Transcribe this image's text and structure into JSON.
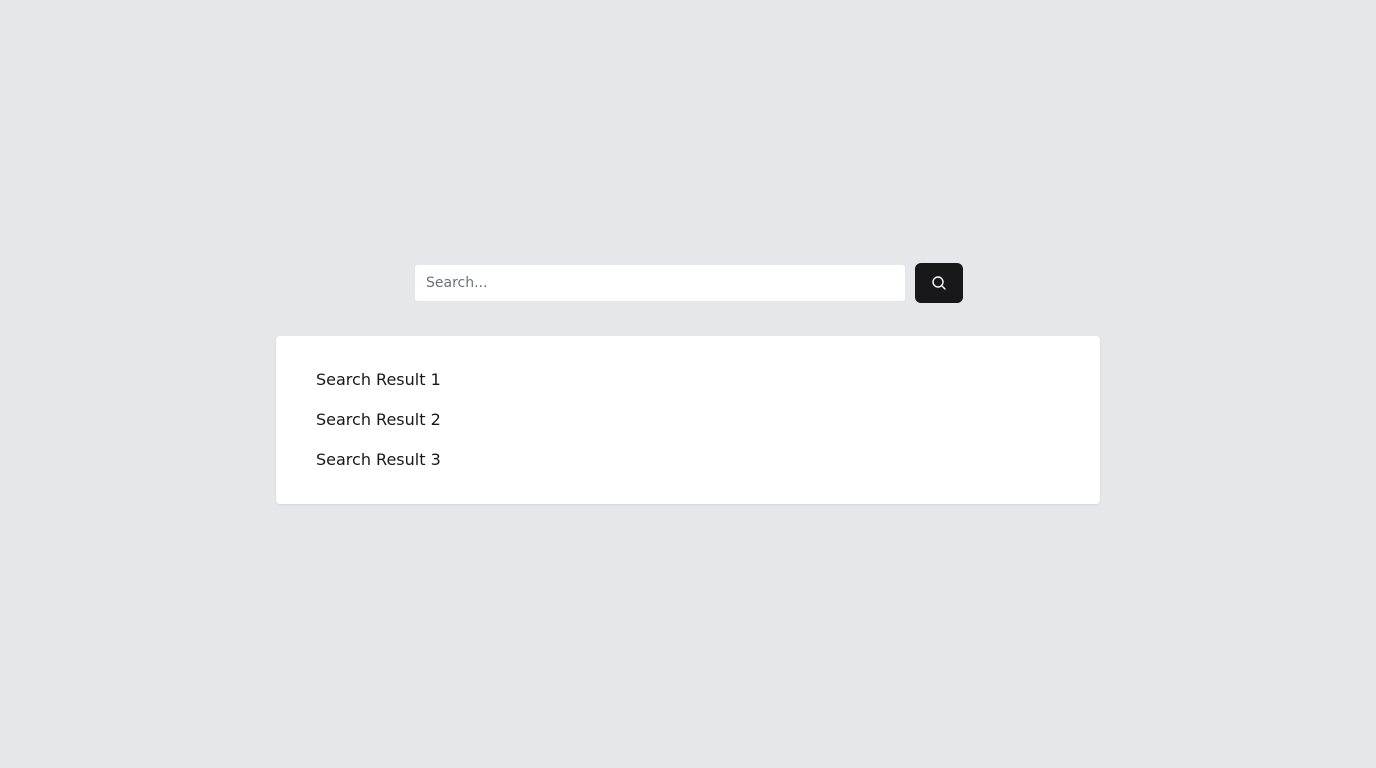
{
  "search": {
    "placeholder": "Search...",
    "value": "",
    "button_icon": "search-icon"
  },
  "results": {
    "items": [
      {
        "label": "Search Result 1"
      },
      {
        "label": "Search Result 2"
      },
      {
        "label": "Search Result 3"
      }
    ]
  },
  "colors": {
    "background": "#e5e7eb",
    "card": "#ffffff",
    "button": "#18181b",
    "text": "#18181b",
    "placeholder": "#6b7280"
  }
}
